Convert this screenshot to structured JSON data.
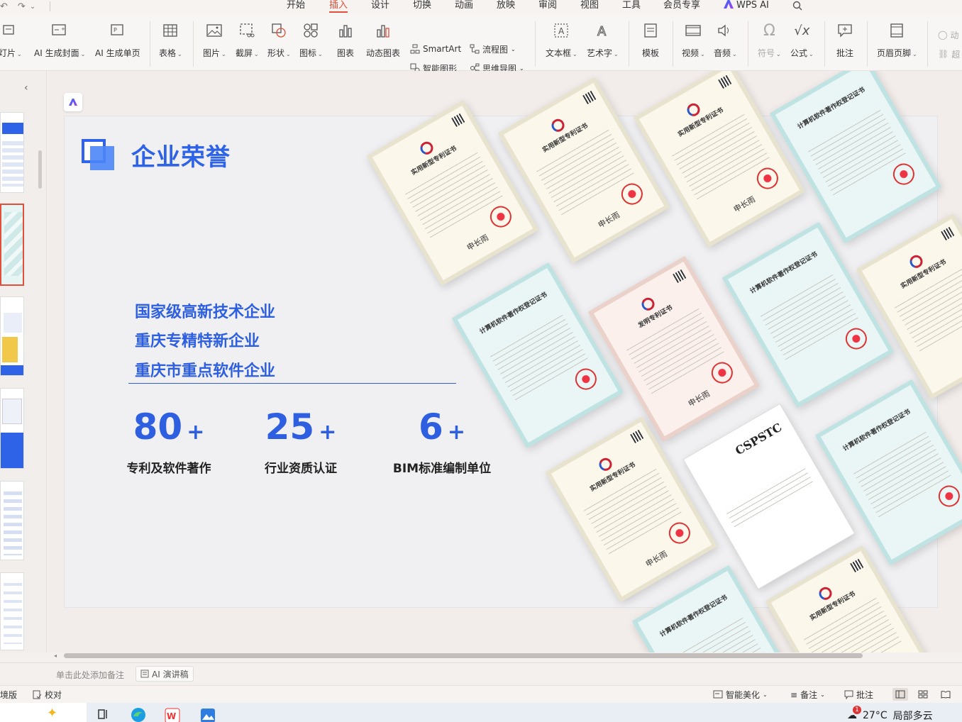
{
  "menu": {
    "items": [
      "开始",
      "插入",
      "设计",
      "切换",
      "动画",
      "放映",
      "审阅",
      "视图",
      "工具",
      "会员专享",
      "WPS AI"
    ],
    "active": "插入"
  },
  "ribbon": {
    "new_slide": "灯片",
    "ai_cover": "AI 生成封面",
    "ai_single": "AI 生成单页",
    "table": "表格",
    "picture": "图片",
    "screenshot": "截屏",
    "shape": "形状",
    "icon": "图标",
    "chart": "图表",
    "dynamic_chart": "动态图表",
    "smartart": "SmartArt",
    "smart_graphic": "智能图形",
    "flowchart": "流程图",
    "mindmap": "思维导图",
    "textbox": "文本框",
    "wordart": "艺术字",
    "template": "模板",
    "video": "视频",
    "audio": "音频",
    "symbol": "符号",
    "formula": "公式",
    "comment": "批注",
    "header_footer": "页眉页脚",
    "action": "动",
    "hyperlink": "超"
  },
  "slide": {
    "title": "企业荣誉",
    "honors": [
      "国家级高新技术企业",
      "重庆专精特新企业",
      "重庆市重点软件企业"
    ],
    "stats": [
      {
        "number": "80",
        "plus": "+",
        "caption": "专利及软件著作"
      },
      {
        "number": "25",
        "plus": "+",
        "caption": "行业资质认证"
      },
      {
        "number": "6",
        "plus": "+",
        "caption": "BIM标准编制单位"
      }
    ],
    "cert_titles": {
      "utility": "实用新型专利证书",
      "invention": "发明专利证书",
      "software": "计算机软件著作权登记证书",
      "signature": "申长雨",
      "cspstc": "CSPSTC"
    }
  },
  "notes": {
    "placeholder": "单击此处添加备注",
    "ai_button": "AI 演讲稿"
  },
  "statusbar": {
    "left_partial": "境版",
    "proofread": "校对",
    "beautify": "智能美化",
    "notes": "备注",
    "comment": "批注"
  },
  "taskbar": {
    "temperature": "27°C",
    "weather": "局部多云",
    "badge": "1"
  }
}
